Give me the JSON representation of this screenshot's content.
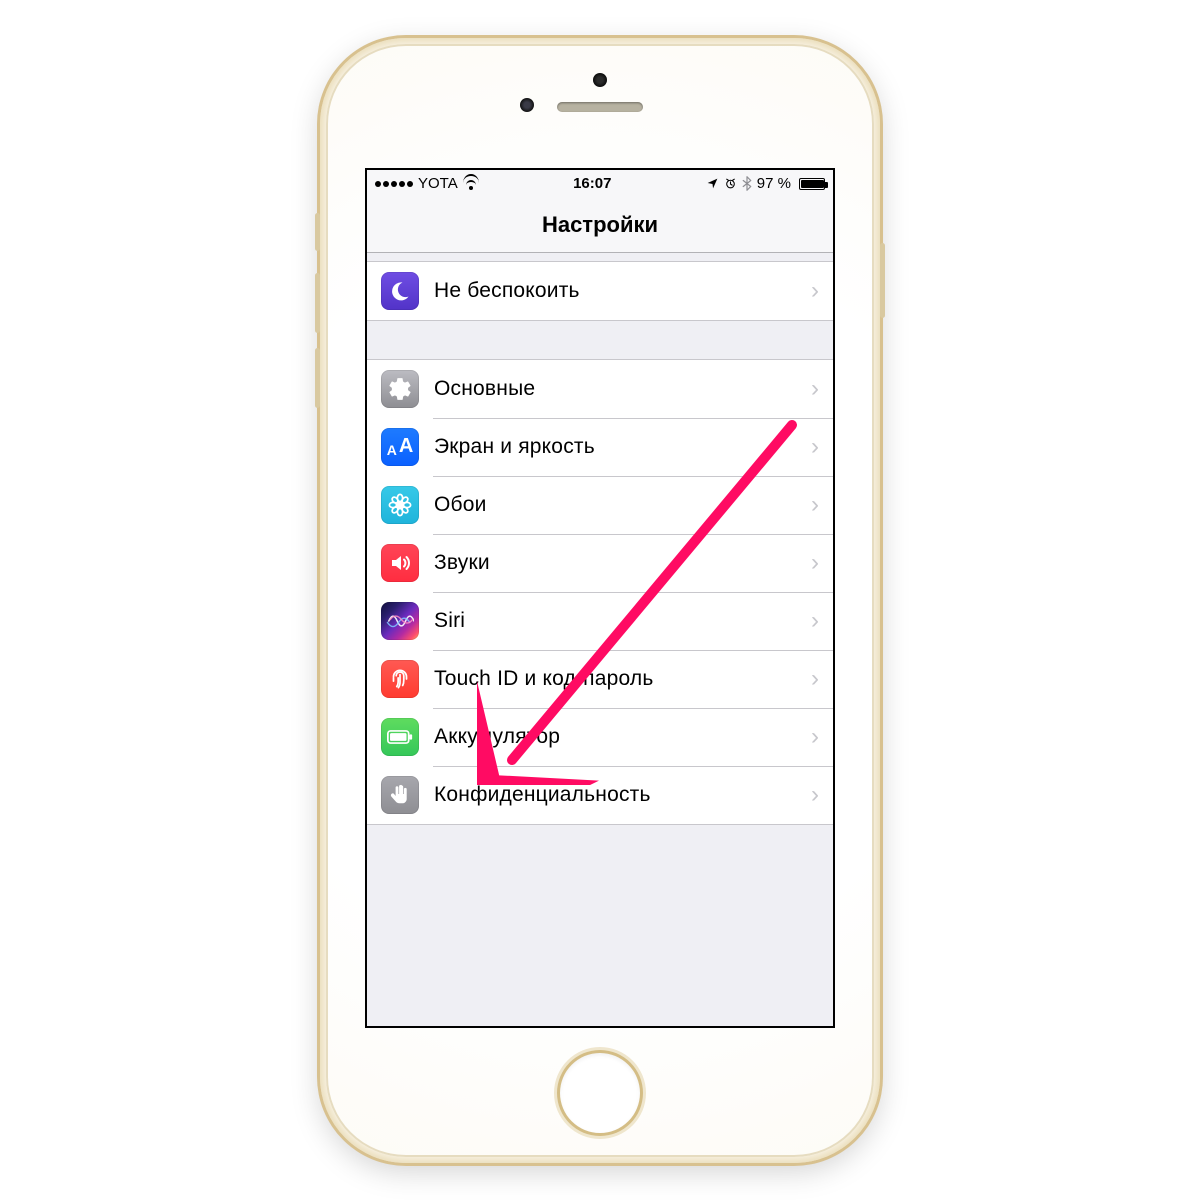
{
  "status": {
    "carrier": "YOTA",
    "time": "16:07",
    "battery_pct": "97 %"
  },
  "header": {
    "title": "Настройки"
  },
  "groups": [
    {
      "rows": [
        {
          "id": "dnd",
          "label": "Не беспокоить",
          "icon": "moon-icon",
          "icon_class": "ic-dnd"
        }
      ]
    },
    {
      "rows": [
        {
          "id": "general",
          "label": "Основные",
          "icon": "gear-icon",
          "icon_class": "ic-general"
        },
        {
          "id": "display",
          "label": "Экран и яркость",
          "icon": "text-size-icon",
          "icon_class": "ic-display"
        },
        {
          "id": "wall",
          "label": "Обои",
          "icon": "flower-icon",
          "icon_class": "ic-wall"
        },
        {
          "id": "sound",
          "label": "Звуки",
          "icon": "speaker-icon",
          "icon_class": "ic-sound"
        },
        {
          "id": "siri",
          "label": "Siri",
          "icon": "siri-icon",
          "icon_class": "ic-siri"
        },
        {
          "id": "touch",
          "label": "Touch ID и код-пароль",
          "icon": "fingerprint-icon",
          "icon_class": "ic-touch"
        },
        {
          "id": "battery",
          "label": "Аккумулятор",
          "icon": "battery-icon",
          "icon_class": "ic-batt"
        },
        {
          "id": "privacy",
          "label": "Конфиденциальность",
          "icon": "hand-icon",
          "icon_class": "ic-priv"
        }
      ]
    }
  ],
  "annotation": {
    "color": "#ff0b63",
    "points_to": "touch"
  }
}
